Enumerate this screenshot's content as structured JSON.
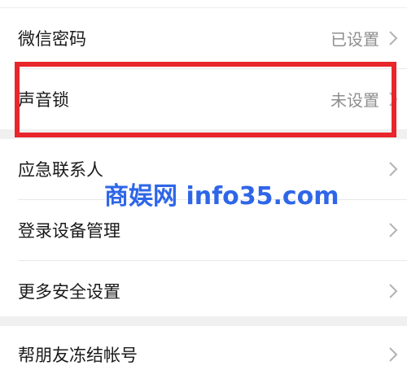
{
  "settings": {
    "rows": [
      {
        "label": "微信密码",
        "value": "已设置"
      },
      {
        "label": "声音锁",
        "value": "未设置"
      },
      {
        "label": "应急联系人",
        "value": ""
      },
      {
        "label": "登录设备管理",
        "value": ""
      },
      {
        "label": "更多安全设置",
        "value": ""
      },
      {
        "label": "帮朋友冻结帐号",
        "value": ""
      }
    ]
  },
  "watermark": {
    "text": "商娱网 info35.com"
  },
  "colors": {
    "highlight": "#e8262c",
    "watermark": "#2f66e8",
    "value_text": "#8f8f8f",
    "group_gap": "#f0f0f0"
  },
  "icons": {
    "chevron": "chevron-right-icon"
  }
}
